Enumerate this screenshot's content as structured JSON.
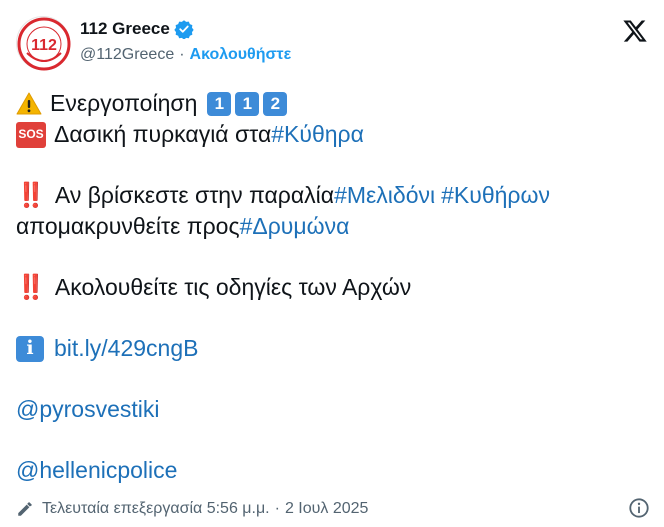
{
  "account": {
    "display_name": "112 Greece",
    "handle": "@112Greece",
    "separator": "·",
    "follow_label": "Ακολουθήστε",
    "avatar_text": "112",
    "avatar_ring_text": "ΕΥΡΩΠΑΪΚΟΣ ΑΡΙΘΜΟΣ ΕΚΤΑΚΤΟΥ ΑΝΑΓΚΗΣ"
  },
  "tweet": {
    "line1": {
      "text": "Ενεργοποίηση",
      "keycaps": [
        "1",
        "1",
        "2"
      ]
    },
    "line2": {
      "badge": "SOS",
      "text": "Δασική πυρκαγιά στα ",
      "hashtag": "#Κύθηρα"
    },
    "line3": {
      "bangs": "‼️",
      "text": "Αν βρίσκεστε στην παραλία ",
      "hashtag1": "#Μελιδόνι",
      "hashtag2": "#Κυθήρων"
    },
    "line4": {
      "text": "απομακρυνθείτε προς ",
      "hashtag": "#Δρυμώνα"
    },
    "line5": {
      "bangs": "‼️",
      "text": "Ακολουθείτε τις οδηγίες των Αρχών"
    },
    "line6": {
      "badge": "i",
      "link": "bit.ly/429cngB"
    },
    "mention1": "@pyrosvestiki",
    "mention2": "@hellenicpolice"
  },
  "footer": {
    "edited_label": "Τελευταία επεξεργασία 5:56 μ.μ.",
    "separator": "·",
    "date": "2 Ιουλ 2025"
  },
  "icons": {
    "brand": "x-logo-icon",
    "verified": "verified-badge-icon",
    "warning": "warning-icon",
    "edit": "pencil-icon",
    "info": "info-circle-icon"
  },
  "colors": {
    "link": "#1d70b8",
    "follow": "#1d9bf0",
    "verified": "#1d9bf0",
    "keycap": "#3d8bd8",
    "sos": "#e0403a",
    "bangs": "#d6232a",
    "secondary_text": "#536471"
  }
}
